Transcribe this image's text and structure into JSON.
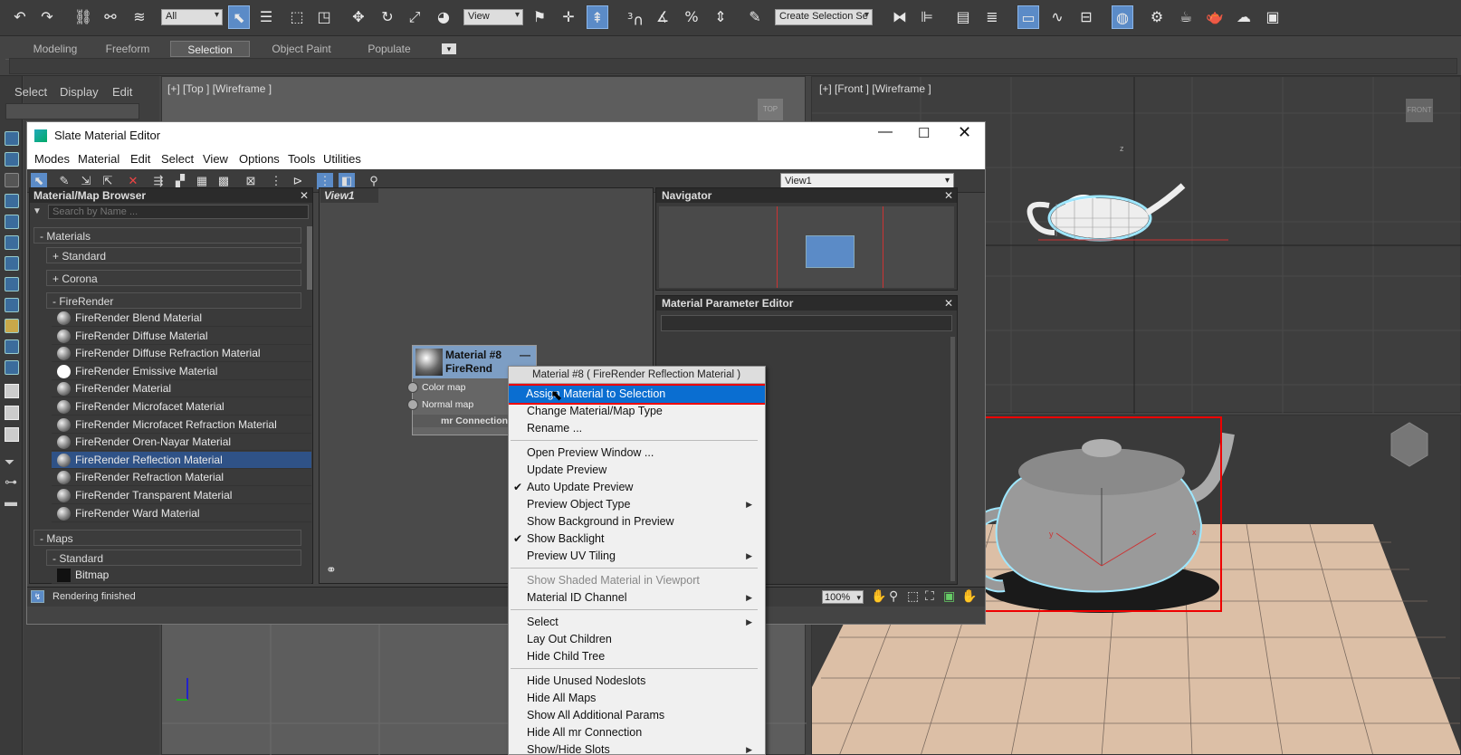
{
  "main_toolbar": {
    "selection_filter": "All",
    "ref_coord": "View",
    "named_sel": "Create Selection Se",
    "snap_label": "3",
    "percent_label": "%"
  },
  "ribbon": {
    "tabs": [
      "Modeling",
      "Freeform",
      "Selection",
      "Object Paint",
      "Populate"
    ]
  },
  "command_panel": {
    "tabs": [
      "Select",
      "Display",
      "Edit"
    ]
  },
  "viewports": {
    "top_label": "[+] [Top ] [Wireframe ]",
    "front_label": "[+] [Front ] [Wireframe ]",
    "top_cube": "TOP",
    "front_cube": "FRONT",
    "axis_y": "y",
    "axis_x": "x",
    "axis_z": "z"
  },
  "slate": {
    "title": "Slate Material Editor",
    "menu": [
      "Modes",
      "Material",
      "Edit",
      "Select",
      "View",
      "Options",
      "Tools",
      "Utilities"
    ],
    "view_dropdown": "View1",
    "view_tab": "View1",
    "browser": {
      "title": "Material/Map Browser",
      "search_placeholder": "Search by Name ...",
      "materials_header": "- Materials",
      "standard_group": "+ Standard",
      "corona_group": "+ Corona",
      "firerender_group": "- FireRender",
      "items": [
        "FireRender Blend Material",
        "FireRender Diffuse Material",
        "FireRender Diffuse Refraction Material",
        "FireRender Emissive Material",
        "FireRender Material",
        "FireRender Microfacet Material",
        "FireRender Microfacet Refraction Material",
        "FireRender Oren-Nayar Material",
        "FireRender Reflection Material",
        "FireRender Refraction Material",
        "FireRender Transparent Material",
        "FireRender Ward Material"
      ],
      "selected_index": 8,
      "maps_header": "- Maps",
      "maps_standard": "- Standard",
      "bitmap": "Bitmap"
    },
    "node": {
      "title": "Material #8",
      "subtitle": "FireRend",
      "slots": [
        "Color map",
        "Normal map"
      ],
      "footer": "mr Connection"
    },
    "navigator_title": "Navigator",
    "param_editor_title": "Material Parameter Editor",
    "status": "Rendering finished",
    "zoom": "100%"
  },
  "context_menu": {
    "header": "Material #8  ( FireRender Reflection Material )",
    "items": [
      {
        "label": "Assign Material to Selection",
        "highlight": true
      },
      {
        "label": "Change Material/Map Type"
      },
      {
        "label": "Rename ..."
      },
      {
        "sep": true
      },
      {
        "label": "Open Preview Window ..."
      },
      {
        "label": "Update Preview"
      },
      {
        "label": "Auto Update Preview",
        "check": true
      },
      {
        "label": "Preview Object Type",
        "sub": true
      },
      {
        "label": "Show Background in Preview"
      },
      {
        "label": "Show Backlight",
        "check": true
      },
      {
        "label": "Preview UV Tiling",
        "sub": true
      },
      {
        "sep": true
      },
      {
        "label": "Show Shaded Material in Viewport",
        "disabled": true
      },
      {
        "label": "Material ID Channel",
        "sub": true
      },
      {
        "sep": true
      },
      {
        "label": "Select",
        "sub": true
      },
      {
        "label": "Lay Out Children"
      },
      {
        "label": "Hide Child Tree"
      },
      {
        "sep": true
      },
      {
        "label": "Hide Unused Nodeslots"
      },
      {
        "label": "Hide All Maps"
      },
      {
        "label": "Show All Additional Params"
      },
      {
        "label": "Hide All mr Connection"
      },
      {
        "label": "Show/Hide Slots",
        "sub": true
      }
    ]
  }
}
